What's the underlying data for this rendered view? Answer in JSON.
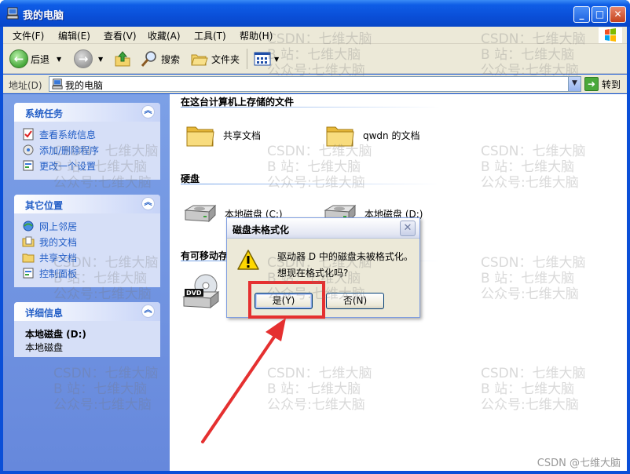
{
  "window": {
    "title": "我的电脑",
    "minimize": "_",
    "maximize": "□",
    "close": "✕"
  },
  "menu": {
    "items": [
      "文件(F)",
      "编辑(E)",
      "查看(V)",
      "收藏(A)",
      "工具(T)",
      "帮助(H)"
    ]
  },
  "toolbar": {
    "back": "后退",
    "search": "搜索",
    "folders": "文件夹"
  },
  "address": {
    "label": "地址(D)",
    "value": "我的电脑",
    "go": "转到"
  },
  "left_pane": {
    "system_tasks": {
      "title": "系统任务",
      "items": [
        "查看系统信息",
        "添加/删除程序",
        "更改一个设置"
      ]
    },
    "other_places": {
      "title": "其它位置",
      "items": [
        "网上邻居",
        "我的文档",
        "共享文档",
        "控制面板"
      ]
    },
    "details": {
      "title": "详细信息",
      "name": "本地磁盘 (D:)",
      "type": "本地磁盘"
    }
  },
  "content": {
    "stored_files": {
      "title": "在这台计算机上存储的文件",
      "items": [
        "共享文档",
        "qwdn 的文档"
      ]
    },
    "hard_disks": {
      "title": "硬盘",
      "items": [
        "本地磁盘 (C:)",
        "本地磁盘 (D:)"
      ]
    },
    "removable": {
      "title": "有可移动存",
      "items": [
        "D"
      ]
    }
  },
  "dialog": {
    "title": "磁盘未格式化",
    "message": "驱动器 D 中的磁盘未被格式化。",
    "question": "想现在格式化吗?",
    "yes": "是(Y)",
    "no": "否(N)"
  },
  "watermark": {
    "lines": "CSDN：七维大脑\nB 站：七维大脑\n公众号:七维大脑",
    "footer": "CSDN @七维大脑"
  }
}
